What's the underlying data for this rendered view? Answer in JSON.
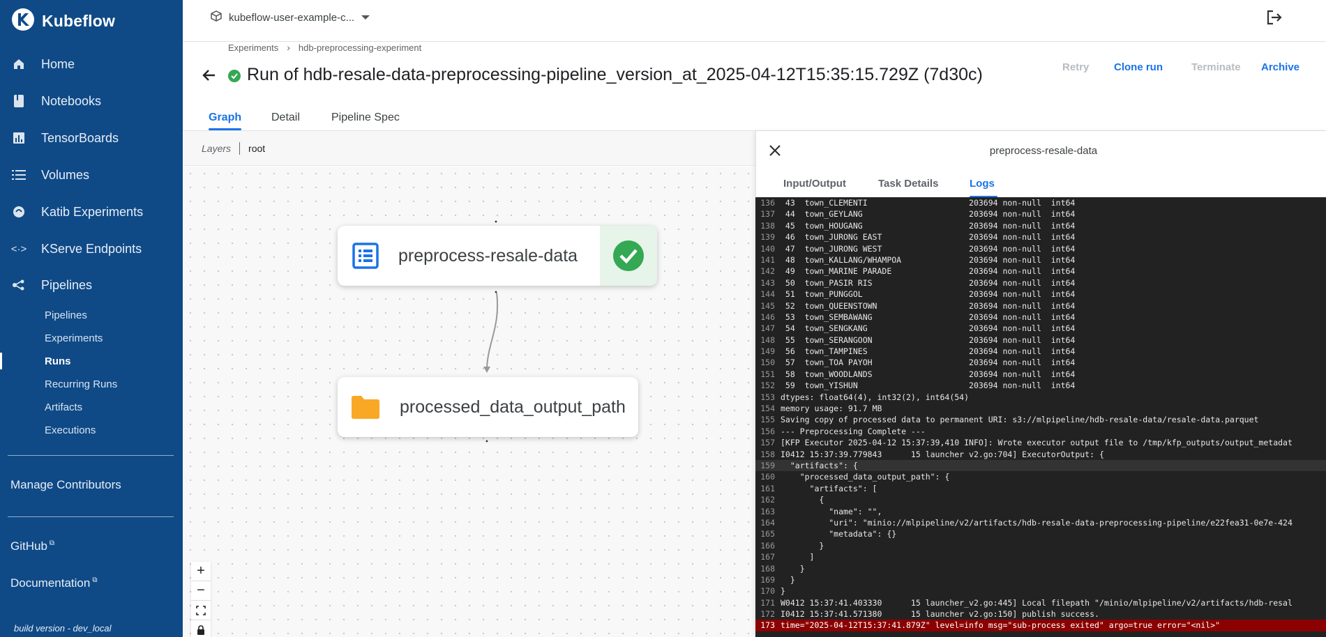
{
  "app": {
    "brand": "Kubeflow"
  },
  "topbar": {
    "namespace": "kubeflow-user-example-c..."
  },
  "sidebar": {
    "items": [
      {
        "label": "Home",
        "icon": "home-icon"
      },
      {
        "label": "Notebooks",
        "icon": "notebook-icon"
      },
      {
        "label": "TensorBoards",
        "icon": "chart-icon"
      },
      {
        "label": "Volumes",
        "icon": "list-icon"
      },
      {
        "label": "Katib Experiments",
        "icon": "katib-icon"
      },
      {
        "label": "KServe Endpoints",
        "icon": "arrows-icon"
      },
      {
        "label": "Pipelines",
        "icon": "pipeline-icon"
      }
    ],
    "sub_items": [
      "Pipelines",
      "Experiments",
      "Runs",
      "Recurring Runs",
      "Artifacts",
      "Executions"
    ],
    "active_sub": "Runs",
    "manage": "Manage Contributors",
    "github": "GitHub",
    "docs": "Documentation",
    "build": "build version - dev_local"
  },
  "breadcrumb": [
    "Experiments",
    "hdb-preprocessing-experiment"
  ],
  "run": {
    "title": "Run of hdb-resale-data-preprocessing-pipeline_version_at_2025-04-12T15:35:15.729Z (7d30c)",
    "status": "succeeded"
  },
  "actions": {
    "retry": "Retry",
    "clone": "Clone run",
    "terminate": "Terminate",
    "archive": "Archive"
  },
  "tabs": [
    "Graph",
    "Detail",
    "Pipeline Spec"
  ],
  "active_tab": "Graph",
  "graph": {
    "layers_label": "Layers",
    "layers_value": "root",
    "nodes": [
      {
        "label": "preprocess-resale-data",
        "kind": "execution",
        "status": "succeeded"
      },
      {
        "label": "processed_data_output_path",
        "kind": "artifact"
      }
    ],
    "zoom": [
      "+",
      "−"
    ]
  },
  "panel": {
    "title": "preprocess-resale-data",
    "tabs": [
      "Input/Output",
      "Task Details",
      "Logs"
    ],
    "active_tab": "Logs"
  },
  "logs": [
    {
      "n": "136",
      "t": " 43  town_CLEMENTI                     203694 non-null  int64"
    },
    {
      "n": "137",
      "t": " 44  town_GEYLANG                      203694 non-null  int64"
    },
    {
      "n": "138",
      "t": " 45  town_HOUGANG                      203694 non-null  int64"
    },
    {
      "n": "139",
      "t": " 46  town_JURONG EAST                  203694 non-null  int64"
    },
    {
      "n": "140",
      "t": " 47  town_JURONG WEST                  203694 non-null  int64"
    },
    {
      "n": "141",
      "t": " 48  town_KALLANG/WHAMPOA              203694 non-null  int64"
    },
    {
      "n": "142",
      "t": " 49  town_MARINE PARADE                203694 non-null  int64"
    },
    {
      "n": "143",
      "t": " 50  town_PASIR RIS                    203694 non-null  int64"
    },
    {
      "n": "144",
      "t": " 51  town_PUNGGOL                      203694 non-null  int64"
    },
    {
      "n": "145",
      "t": " 52  town_QUEENSTOWN                   203694 non-null  int64"
    },
    {
      "n": "146",
      "t": " 53  town_SEMBAWANG                    203694 non-null  int64"
    },
    {
      "n": "147",
      "t": " 54  town_SENGKANG                     203694 non-null  int64"
    },
    {
      "n": "148",
      "t": " 55  town_SERANGOON                    203694 non-null  int64"
    },
    {
      "n": "149",
      "t": " 56  town_TAMPINES                     203694 non-null  int64"
    },
    {
      "n": "150",
      "t": " 57  town_TOA PAYOH                    203694 non-null  int64"
    },
    {
      "n": "151",
      "t": " 58  town_WOODLANDS                    203694 non-null  int64"
    },
    {
      "n": "152",
      "t": " 59  town_YISHUN                       203694 non-null  int64"
    },
    {
      "n": "153",
      "t": "dtypes: float64(4), int32(2), int64(54)"
    },
    {
      "n": "154",
      "t": "memory usage: 91.7 MB"
    },
    {
      "n": "155",
      "t": "Saving copy of processed data to permanent URI: s3://mlpipeline/hdb-resale-data/resale-data.parquet"
    },
    {
      "n": "156",
      "t": "--- Preprocessing Complete ---"
    },
    {
      "n": "157",
      "t": "[KFP Executor 2025-04-12 15:37:39,410 INFO]: Wrote executor output file to /tmp/kfp_outputs/output_metadat"
    },
    {
      "n": "158",
      "t": "I0412 15:37:39.779843      15 launcher v2.go:704] ExecutorOutput: {"
    },
    {
      "n": "159",
      "t": "  \"artifacts\": {",
      "hl": true
    },
    {
      "n": "160",
      "t": "    \"processed_data_output_path\": {"
    },
    {
      "n": "161",
      "t": "      \"artifacts\": ["
    },
    {
      "n": "162",
      "t": "        {"
    },
    {
      "n": "163",
      "t": "          \"name\": \"\","
    },
    {
      "n": "164",
      "t": "          \"uri\": \"minio://mlpipeline/v2/artifacts/hdb-resale-data-preprocessing-pipeline/e22fea31-0e7e-424"
    },
    {
      "n": "165",
      "t": "          \"metadata\": {}"
    },
    {
      "n": "166",
      "t": "        }"
    },
    {
      "n": "167",
      "t": "      ]"
    },
    {
      "n": "168",
      "t": "    }"
    },
    {
      "n": "169",
      "t": "  }"
    },
    {
      "n": "170",
      "t": "}"
    },
    {
      "n": "171",
      "t": "W0412 15:37:41.403330      15 launcher_v2.go:445] Local filepath \"/minio/mlpipeline/v2/artifacts/hdb-resal"
    },
    {
      "n": "172",
      "t": "I0412 15:37:41.571380      15 launcher v2.go:150] publish success."
    },
    {
      "n": "173",
      "t": "time=\"2025-04-12T15:37:41.879Z\" level=info msg=\"sub-process exited\" argo=true error=\"<nil>\"",
      "err": true
    }
  ],
  "colors": {
    "sidebar": "#0f4a87",
    "accent": "#1a73e8",
    "success": "#34a853",
    "log_bg": "#222222",
    "log_error": "#8b0000",
    "artifact": "#f9a825"
  }
}
